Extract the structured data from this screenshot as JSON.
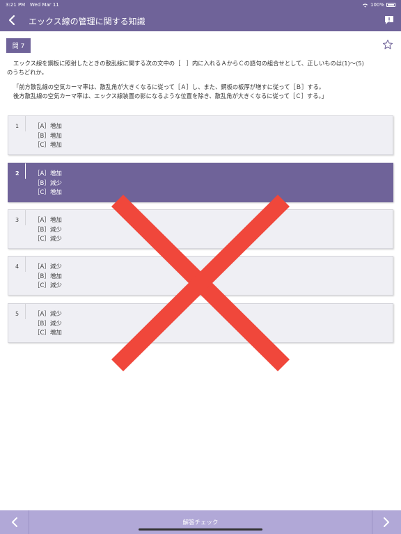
{
  "status_bar": {
    "time": "3:21 PM",
    "date": "Wed Mar 11",
    "battery": "100%"
  },
  "nav": {
    "title": "エックス線の管理に関する知識",
    "back_icon": "chevron-left-icon",
    "comment_icon": "comment-icon"
  },
  "question": {
    "badge": "問 7",
    "text_line1": "エックス線を鋼板に照射したときの散乱線に関する次の文中の［　］内に入れるＡからＣの語句の組合せとして、正しいものは(1)～(5)",
    "text_line2": "のうちどれか。",
    "quote_line1": "「前方散乱線の空気カーマ率は、散乱角が大きくなるに従って［Ａ］し、また、鋼板の板厚が増すに従って［Ｂ］する。",
    "quote_line2": "後方散乱線の空気カーマ率は、エックス線装置の影になるような位置を除き、散乱角が大きくなるに従って［Ｃ］する。」"
  },
  "choices": [
    {
      "num": "1",
      "a": "［A］増加",
      "b": "［B］増加",
      "c": "［C］増加",
      "selected": false
    },
    {
      "num": "2",
      "a": "［A］増加",
      "b": "［B］減少",
      "c": "［C］増加",
      "selected": true
    },
    {
      "num": "3",
      "a": "［A］増加",
      "b": "［B］減少",
      "c": "［C］減少",
      "selected": false
    },
    {
      "num": "4",
      "a": "［A］減少",
      "b": "［B］増加",
      "c": "［C］減少",
      "selected": false
    },
    {
      "num": "5",
      "a": "［A］減少",
      "b": "［B］減少",
      "c": "［C］増加",
      "selected": false
    }
  ],
  "result_mark": "incorrect",
  "bottom_bar": {
    "check_label": "解答チェック"
  },
  "colors": {
    "primary": "#6f6399",
    "bottom_bar": "#b1a8d7",
    "cross": "#f0473b",
    "choice_bg": "#efeff4"
  }
}
